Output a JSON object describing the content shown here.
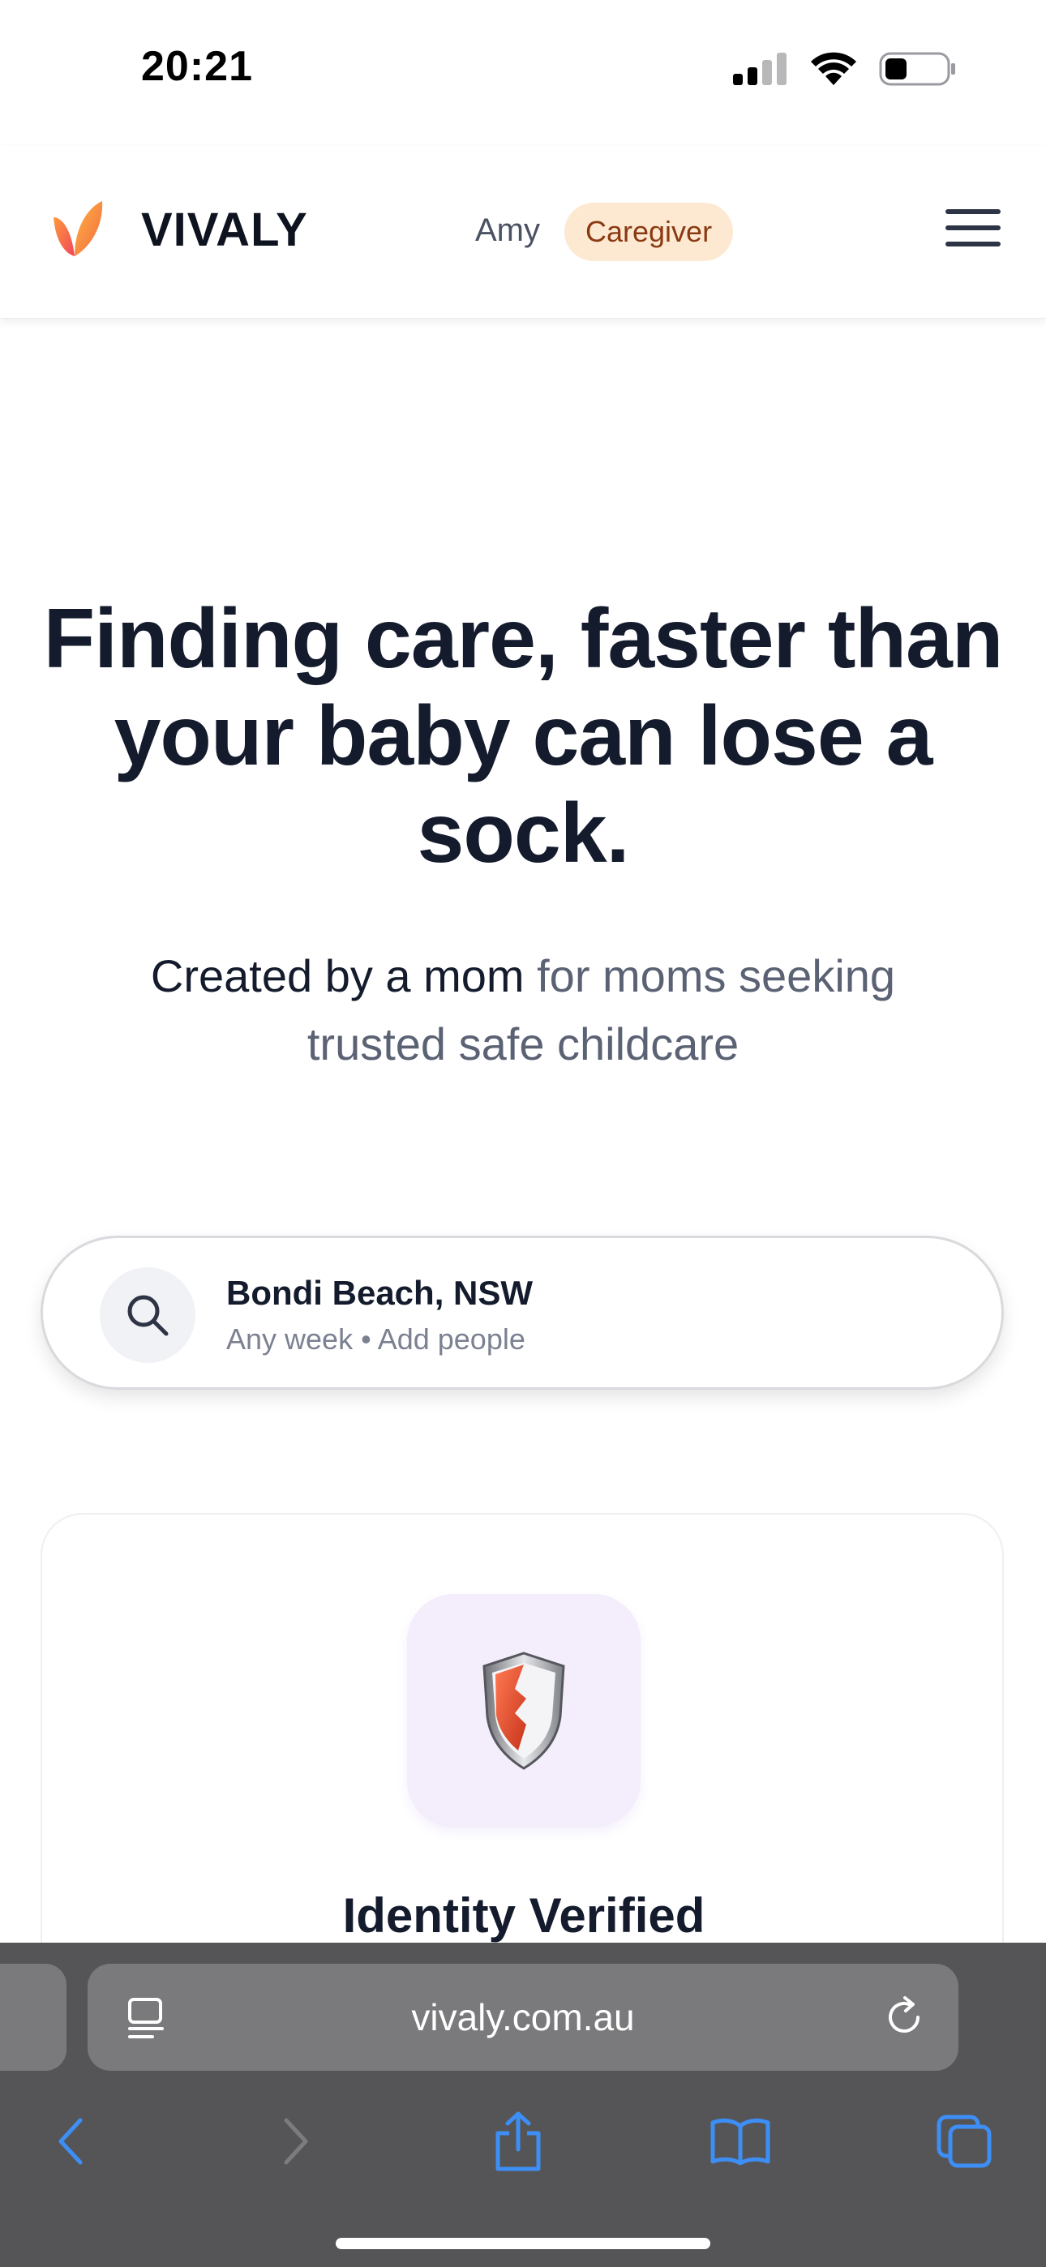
{
  "status_bar": {
    "time": "20:21"
  },
  "header": {
    "brand_name": "VIVALY",
    "user_name": "Amy",
    "role_badge": "Caregiver"
  },
  "hero": {
    "title": "Finding care, faster than your baby can lose a sock.",
    "subtitle_strong": "Created by a mom",
    "subtitle_rest": " for moms seeking trusted safe childcare"
  },
  "search": {
    "location": "Bondi Beach, NSW",
    "meta": "Any week • Add people"
  },
  "feature": {
    "title": "Identity Verified",
    "icon": "shield-icon"
  },
  "browser": {
    "url": "vivaly.com.au"
  },
  "colors": {
    "accent_orange": "#f26a3c",
    "badge_bg": "#fde9d2",
    "badge_text": "#8a3a12",
    "link_blue": "#3b82f6"
  }
}
